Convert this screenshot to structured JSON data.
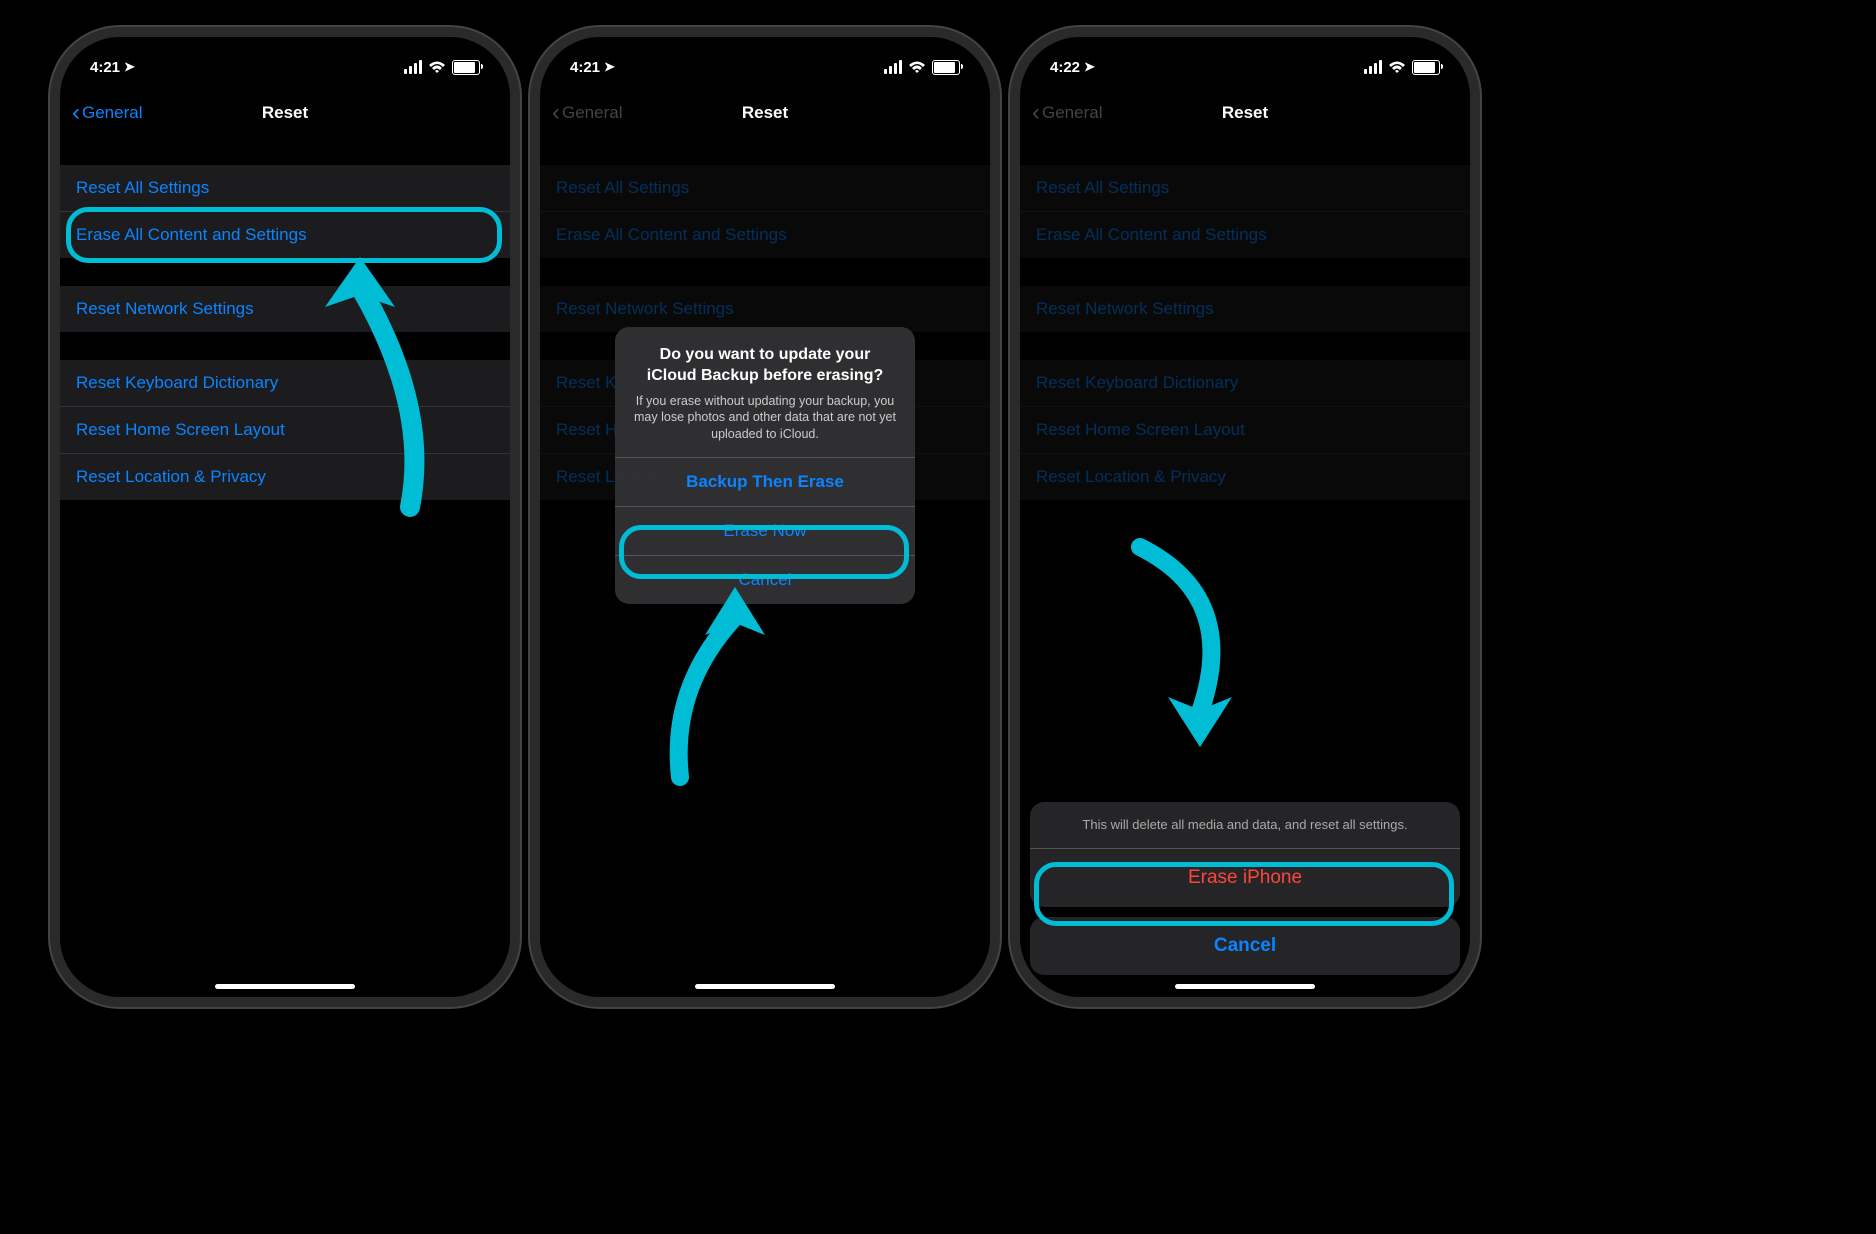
{
  "colors": {
    "highlight": "#00bcd4",
    "link": "#0a84ff",
    "destructive": "#ff453a"
  },
  "phones": [
    {
      "time": "4:21",
      "back_label": "General",
      "title": "Reset",
      "groups": [
        [
          "Reset All Settings",
          "Erase All Content and Settings"
        ],
        [
          "Reset Network Settings"
        ],
        [
          "Reset Keyboard Dictionary",
          "Reset Home Screen Layout",
          "Reset Location & Privacy"
        ]
      ],
      "highlight_row": "Erase All Content and Settings"
    },
    {
      "time": "4:21",
      "back_label": "General",
      "title": "Reset",
      "groups": [
        [
          "Reset All Settings",
          "Erase All Content and Settings"
        ],
        [
          "Reset Network Settings"
        ],
        [
          "Reset Keyboard Dictionary",
          "Reset Home Screen Layout",
          "Reset Location & Privacy"
        ]
      ],
      "modal": {
        "title": "Do you want to update your iCloud Backup before erasing?",
        "message": "If you erase without updating your backup, you may lose photos and other data that are not yet uploaded to iCloud.",
        "buttons": [
          "Backup Then Erase",
          "Erase Now",
          "Cancel"
        ],
        "highlight_button": "Erase Now"
      }
    },
    {
      "time": "4:22",
      "back_label": "General",
      "title": "Reset",
      "groups": [
        [
          "Reset All Settings",
          "Erase All Content and Settings"
        ],
        [
          "Reset Network Settings"
        ],
        [
          "Reset Keyboard Dictionary",
          "Reset Home Screen Layout",
          "Reset Location & Privacy"
        ]
      ],
      "action_sheet": {
        "message": "This will delete all media and data, and reset all settings.",
        "destructive": "Erase iPhone",
        "cancel": "Cancel",
        "highlight_button": "Erase iPhone"
      }
    }
  ]
}
